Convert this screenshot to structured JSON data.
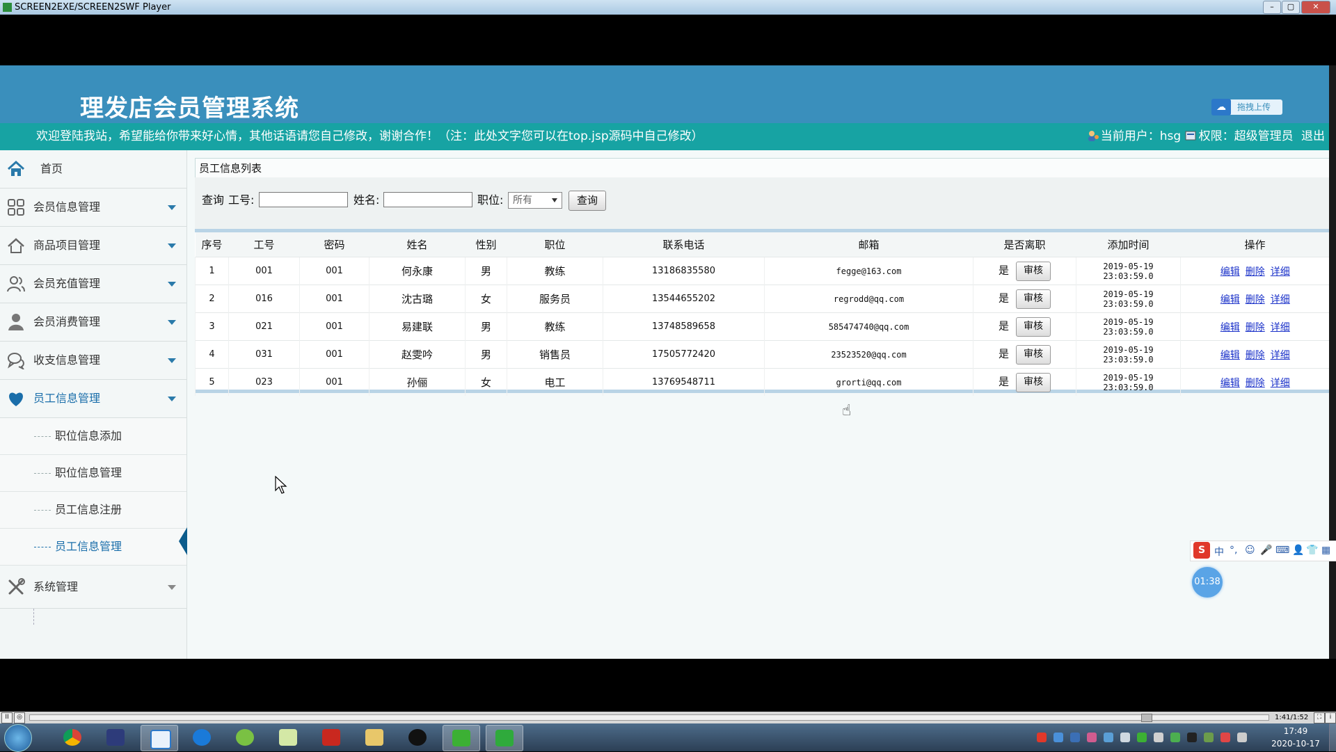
{
  "window": {
    "title": "SCREEN2EXE/SCREEN2SWF Player",
    "min": "–",
    "max": "▢",
    "close": "✕"
  },
  "header": {
    "logo": "理发店会员管理系统",
    "upload_label": "拖拽上传",
    "welcome": "欢迎登陆我站，希望能给你带来好心情，其他话语请您自己修改，谢谢合作！（注：此处文字您可以在top.jsp源码中自己修改）",
    "current_user_label": "当前用户：hsg",
    "role_label": "权限：超级管理员",
    "logout": "退出"
  },
  "sidebar": {
    "home": "首页",
    "menus": [
      {
        "label": "会员信息管理"
      },
      {
        "label": "商品项目管理"
      },
      {
        "label": "会员充值管理"
      },
      {
        "label": "会员消费管理"
      },
      {
        "label": "收支信息管理"
      },
      {
        "label": "员工信息管理"
      }
    ],
    "submenu": [
      {
        "label": "职位信息添加"
      },
      {
        "label": "职位信息管理"
      },
      {
        "label": "员工信息注册"
      },
      {
        "label": "员工信息管理"
      }
    ],
    "system": "系统管理"
  },
  "panel": {
    "title": "员工信息列表"
  },
  "search": {
    "query_label": "查询",
    "id_label": "工号:",
    "id_value": "",
    "name_label": "姓名:",
    "name_value": "",
    "position_label": "职位:",
    "position_selected": "所有",
    "button": "查询"
  },
  "table": {
    "columns": [
      "序号",
      "工号",
      "密码",
      "姓名",
      "性别",
      "职位",
      "联系电话",
      "邮箱",
      "是否离职",
      "添加时间",
      "操作"
    ],
    "rows": [
      {
        "seq": "1",
        "id": "001",
        "pwd": "001",
        "name": "何永康",
        "gender": "男",
        "position": "教练",
        "phone": "13186835580",
        "email": "fegge@163.com",
        "resigned": "是",
        "added": "2019-05-19 23:03:59.0"
      },
      {
        "seq": "2",
        "id": "016",
        "pwd": "001",
        "name": "沈古璐",
        "gender": "女",
        "position": "服务员",
        "phone": "13544655202",
        "email": "regrodd@qq.com",
        "resigned": "是",
        "added": "2019-05-19 23:03:59.0"
      },
      {
        "seq": "3",
        "id": "021",
        "pwd": "001",
        "name": "易建联",
        "gender": "男",
        "position": "教练",
        "phone": "13748589658",
        "email": "585474740@qq.com",
        "resigned": "是",
        "added": "2019-05-19 23:03:59.0"
      },
      {
        "seq": "4",
        "id": "031",
        "pwd": "001",
        "name": "赵雯吟",
        "gender": "男",
        "position": "销售员",
        "phone": "17505772420",
        "email": "23523520@qq.com",
        "resigned": "是",
        "added": "2019-05-19 23:03:59.0"
      },
      {
        "seq": "5",
        "id": "023",
        "pwd": "001",
        "name": "孙俪",
        "gender": "女",
        "position": "电工",
        "phone": "13769548711",
        "email": "grorti@qq.com",
        "resigned": "是",
        "added": "2019-05-19 23:03:59.0"
      }
    ],
    "audit_label": "审核",
    "ops": [
      "编辑",
      "删除",
      "详细"
    ]
  },
  "ime": {
    "mode": "中",
    "items": [
      "°,",
      "☺",
      "🎤",
      "⌨",
      "👤",
      "👕",
      "▦"
    ]
  },
  "timer": "01:38",
  "player": {
    "time": "1:41/1:52",
    "pause": "II",
    "stop": "◎"
  },
  "taskbar": {
    "time": "17:49",
    "date": "2020-10-17"
  },
  "colors": {
    "banner": "#3a8fbc",
    "infobar": "#17a3a3",
    "link": "#1a31c9",
    "active": "#1a6eaa"
  },
  "icons": {
    "home": "home-icon",
    "member": "grid-icon",
    "goods": "house-icon",
    "recharge": "users-icon",
    "consume": "person-icon",
    "finance": "chat-icon",
    "staff": "heart-icon",
    "system": "tools-icon"
  }
}
